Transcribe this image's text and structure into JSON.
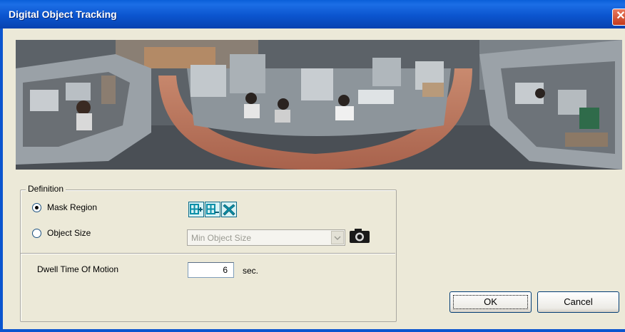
{
  "window": {
    "title": "Digital Object Tracking",
    "close_glyph": "✕"
  },
  "definition": {
    "legend": "Definition",
    "mask_region_label": "Mask Region",
    "mask_region_selected": true,
    "object_size_label": "Object Size",
    "object_size_selected": false,
    "object_size_select_value": "Min Object Size",
    "mask_tools": [
      "add-region-icon",
      "remove-region-icon",
      "clear-region-icon"
    ]
  },
  "dwell": {
    "label": "Dwell Time Of Motion",
    "value": "6",
    "unit": "sec."
  },
  "buttons": {
    "ok": "OK",
    "cancel": "Cancel"
  },
  "colors": {
    "titlebar": "#0b55cf",
    "dialog_bg": "#ece9d8",
    "tool_icon": "#0a8fa8"
  }
}
